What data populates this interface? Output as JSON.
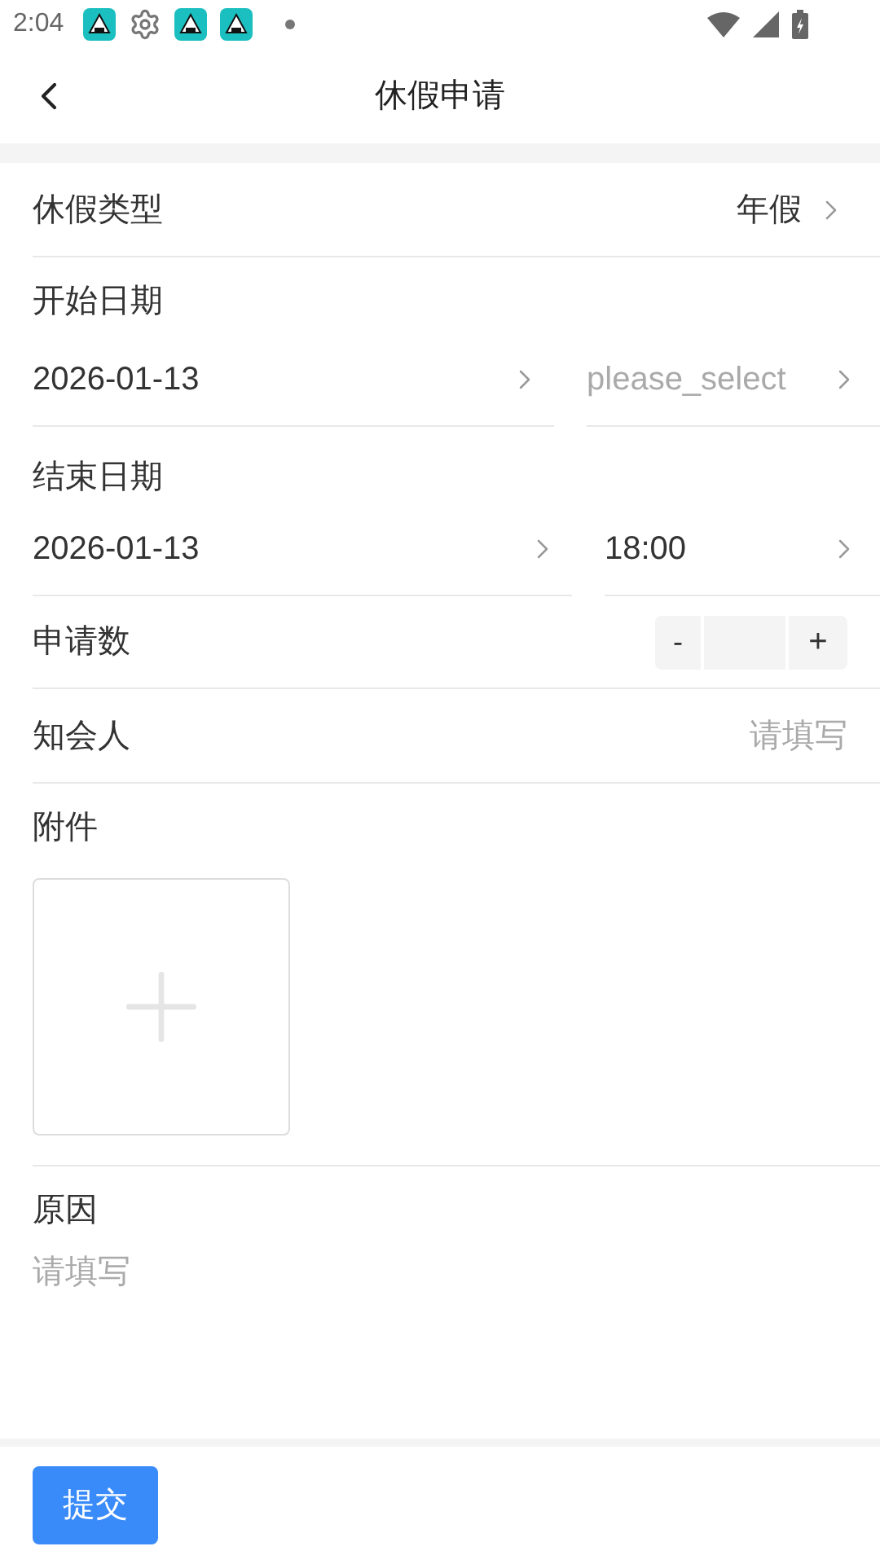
{
  "status_bar": {
    "time": "2:04"
  },
  "header": {
    "title": "休假申请"
  },
  "leave_type": {
    "label": "休假类型",
    "value": "年假"
  },
  "start": {
    "label": "开始日期",
    "date": "2026-01-13",
    "time": {
      "placeholder": "please_select"
    }
  },
  "end": {
    "label": "结束日期",
    "date": "2026-01-13",
    "time": {
      "value": "18:00"
    }
  },
  "amount": {
    "label": "申请数",
    "minus": "-",
    "plus": "+"
  },
  "notify": {
    "label": "知会人",
    "placeholder": "请填写"
  },
  "attachment": {
    "label": "附件"
  },
  "reason": {
    "label": "原因",
    "placeholder": "请填写"
  },
  "submit": "提交"
}
